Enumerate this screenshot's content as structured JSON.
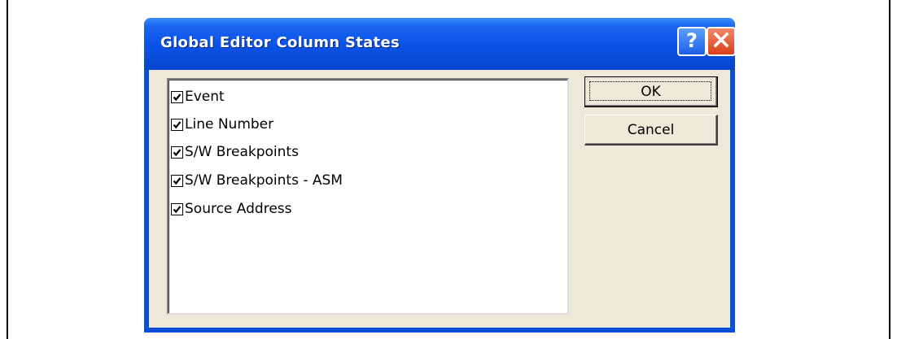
{
  "dialog": {
    "title": "Global Editor Column States",
    "help_icon": "help-icon",
    "close_icon": "close-icon"
  },
  "columns": [
    {
      "label": "Event",
      "checked": true
    },
    {
      "label": "Line Number",
      "checked": true
    },
    {
      "label": "S/W Breakpoints",
      "checked": true
    },
    {
      "label": "S/W Breakpoints - ASM",
      "checked": true
    },
    {
      "label": "Source Address",
      "checked": true
    }
  ],
  "buttons": {
    "ok_label": "OK",
    "cancel_label": "Cancel"
  },
  "colors": {
    "titlebar": "#0a52e6",
    "dialog_face": "#ece9d8",
    "close_button": "#d8401c"
  }
}
